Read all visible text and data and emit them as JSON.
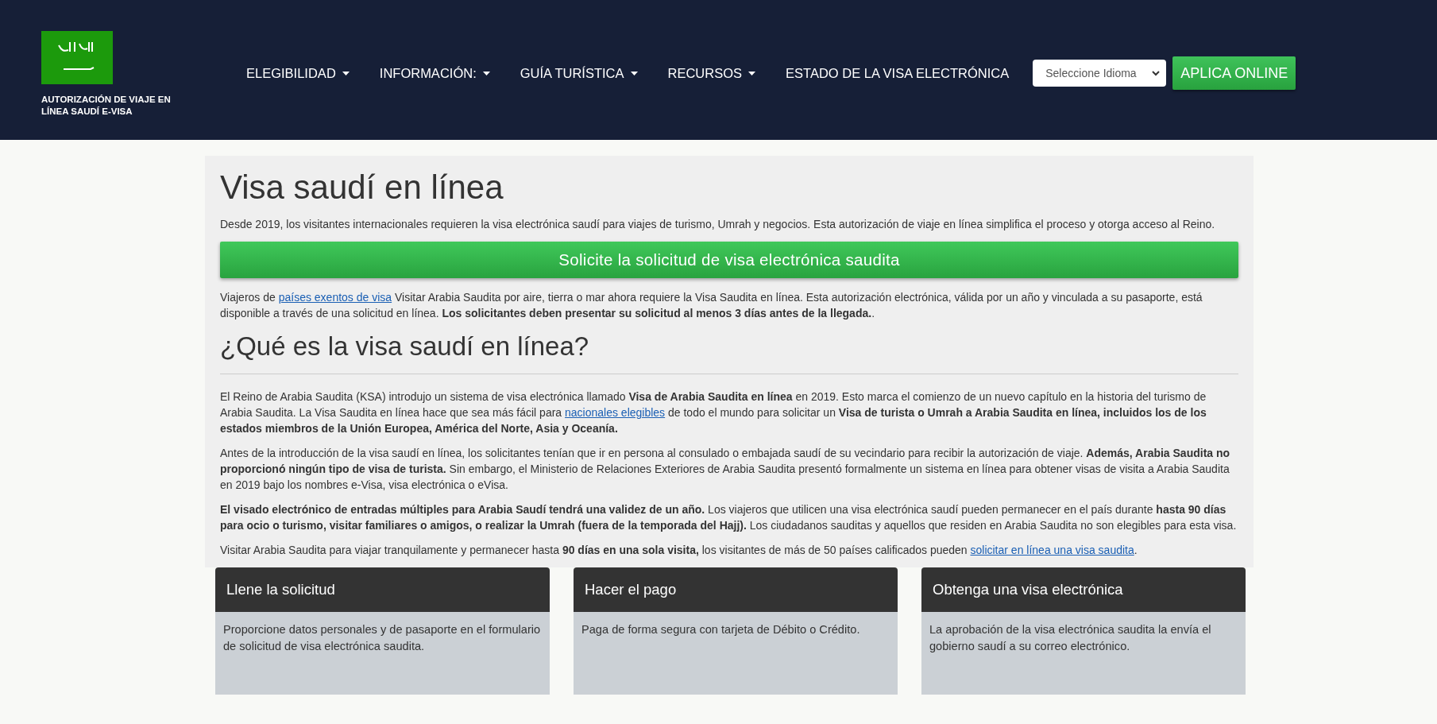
{
  "header": {
    "logo_caption": "AUTORIZACIÓN DE VIAJE EN LÍNEA SAUDÍ E-VISA",
    "nav": [
      {
        "label": "ELEGIBILIDAD",
        "dropdown": true
      },
      {
        "label": "INFORMACIÓN:",
        "dropdown": true
      },
      {
        "label": "GUÍA TURÍSTICA",
        "dropdown": true
      },
      {
        "label": "RECURSOS",
        "dropdown": true
      },
      {
        "label": "ESTADO DE LA VISA ELECTRÓNICA",
        "dropdown": false
      }
    ],
    "language_select": {
      "value": "Seleccione Idioma"
    },
    "apply_button": "APLICA ONLINE"
  },
  "main": {
    "title": "Visa saudí en línea",
    "intro": "Desde 2019, los visitantes internacionales requieren la visa electrónica saudí para viajes de turismo, Umrah y negocios. Esta autorización de viaje en línea simplifica el proceso y otorga acceso al Reino.",
    "cta_button": "Solicite la solicitud de visa electrónica saudita",
    "paragraph": [
      {
        "kind": "text",
        "text": "Viajeros de "
      },
      {
        "kind": "link",
        "text": "países exentos de visa"
      },
      {
        "kind": "text",
        "text": " Visitar Arabia Saudita por aire, tierra o mar ahora requiere la Visa Saudita en línea. Esta autorización electrónica, válida por un año y vinculada a su pasaporte, está disponible a través de una solicitud en línea. "
      },
      {
        "kind": "bold",
        "text": "Los solicitantes deben presentar su solicitud al menos 3 días antes de la llegada."
      },
      {
        "kind": "text",
        "text": "."
      }
    ],
    "section_title": "¿Qué es la visa saudí en línea?",
    "section_paragraphs": [
      [
        {
          "kind": "text",
          "text": "El Reino de Arabia Saudita (KSA) introdujo un sistema de visa electrónica llamado "
        },
        {
          "kind": "bold",
          "text": "Visa de Arabia Saudita en línea"
        },
        {
          "kind": "text",
          "text": " en 2019. Esto marca el comienzo de un nuevo capítulo en la historia del turismo de Arabia Saudita. La Visa Saudita en línea hace que sea más fácil para "
        },
        {
          "kind": "link",
          "text": "nacionales elegibles"
        },
        {
          "kind": "text",
          "text": " de todo el mundo para solicitar un "
        },
        {
          "kind": "bold",
          "text": "Visa de turista o Umrah a Arabia Saudita en línea, incluidos los de los estados miembros de la Unión Europea, América del Norte, Asia y Oceanía."
        }
      ],
      [
        {
          "kind": "text",
          "text": "Antes de la introducción de la visa saudí en línea, los solicitantes tenían que ir en persona al consulado o embajada saudí de su vecindario para recibir la autorización de viaje. "
        },
        {
          "kind": "bold",
          "text": "Además, Arabia Saudita no proporcionó ningún tipo de visa de turista."
        },
        {
          "kind": "text",
          "text": " Sin embargo, el Ministerio de Relaciones Exteriores de Arabia Saudita presentó formalmente un sistema en línea para obtener visas de visita a Arabia Saudita en 2019 bajo los nombres e-Visa, visa electrónica o eVisa."
        }
      ],
      [
        {
          "kind": "bold",
          "text": "El visado electrónico de entradas múltiples para Arabia Saudí tendrá una validez de un año."
        },
        {
          "kind": "text",
          "text": " Los viajeros que utilicen una visa electrónica saudí pueden permanecer en el país durante "
        },
        {
          "kind": "bold",
          "text": "hasta 90 días para ocio o turismo, visitar familiares o amigos, o realizar la Umrah (fuera de la temporada del Hajj)."
        },
        {
          "kind": "text",
          "text": " Los ciudadanos sauditas y aquellos que residen en Arabia Saudita no son elegibles para esta visa."
        }
      ],
      [
        {
          "kind": "text",
          "text": "Visitar Arabia Saudita para viajar tranquilamente y permanecer hasta "
        },
        {
          "kind": "bold",
          "text": "90 días en una sola visita,"
        },
        {
          "kind": "text",
          "text": " los visitantes de más de 50 países calificados pueden "
        },
        {
          "kind": "link",
          "text": "solicitar en línea una visa saudita"
        },
        {
          "kind": "text",
          "text": "."
        }
      ]
    ]
  },
  "steps": [
    {
      "title": "Llene la solicitud",
      "text": "Proporcione datos personales y de pasaporte en el formulario de solicitud de visa electrónica saudita."
    },
    {
      "title": "Hacer el pago",
      "text": "Paga de forma segura con tarjeta de Débito o Crédito."
    },
    {
      "title": "Obtenga una visa electrónica",
      "text": "La aprobación de la visa electrónica saudita la envía el gobierno saudí a su correo electrónico."
    }
  ]
}
